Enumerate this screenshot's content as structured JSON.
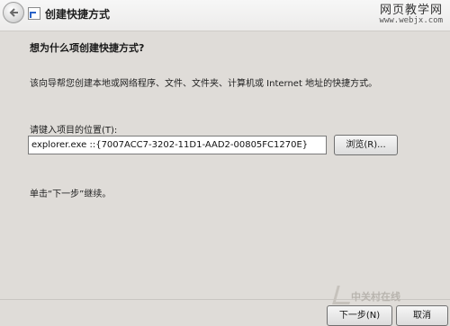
{
  "window": {
    "title": "创建快捷方式"
  },
  "watermark_top": {
    "name": "网页教学网",
    "url": "www.webjx.com"
  },
  "page": {
    "heading": "想为什么项创建快捷方式?",
    "description": "该向导帮您创建本地或网络程序、文件、文件夹、计算机或 Internet 地址的快捷方式。",
    "location_label": "请键入项目的位置(T):",
    "location_value": "explorer.exe ::{7007ACC7-3202-11D1-AAD2-00805FC1270E}",
    "browse_label": "浏览(R)...",
    "hint": "单击“下一步”继续。"
  },
  "footer": {
    "next_label": "下一步(N)",
    "cancel_label": "取消"
  },
  "watermark_bottom": {
    "name": "中关村在线"
  },
  "icons": [
    "back-arrow-icon",
    "shortcut-icon"
  ],
  "colors": {
    "background": "#dfdcd8",
    "titlebar": "#f2f1f0",
    "accent": "#2a63c8"
  }
}
